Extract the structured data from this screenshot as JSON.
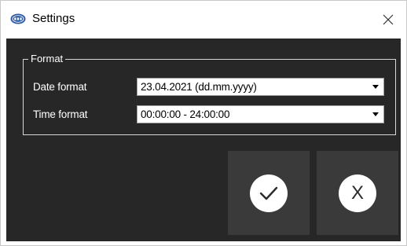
{
  "window": {
    "title": "Settings",
    "icon": "pce-logo-icon",
    "close_icon": "close-icon",
    "background": "#272727",
    "button_background": "#3a3a3a"
  },
  "format_group": {
    "legend": "Format",
    "date_format": {
      "label": "Date format",
      "value": "23.04.2021 (dd.mm.yyyy)"
    },
    "time_format": {
      "label": "Time format",
      "value": "00:00:00 - 24:00:00"
    }
  },
  "buttons": {
    "ok_icon": "checkmark-icon",
    "cancel_icon": "x-icon",
    "cancel_glyph": "X"
  }
}
